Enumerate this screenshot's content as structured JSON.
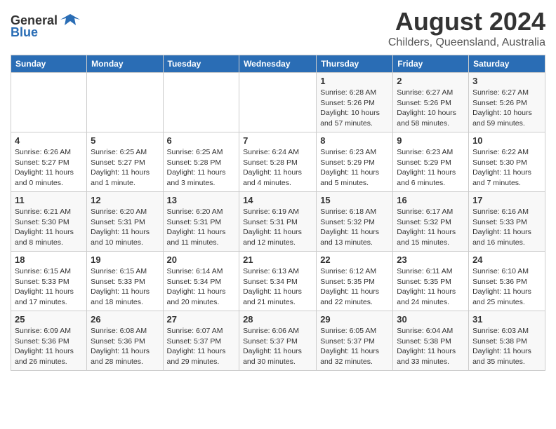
{
  "header": {
    "logo_general": "General",
    "logo_blue": "Blue",
    "title": "August 2024",
    "subtitle": "Childers, Queensland, Australia"
  },
  "calendar": {
    "days_of_week": [
      "Sunday",
      "Monday",
      "Tuesday",
      "Wednesday",
      "Thursday",
      "Friday",
      "Saturday"
    ],
    "weeks": [
      [
        {
          "day": "",
          "info": ""
        },
        {
          "day": "",
          "info": ""
        },
        {
          "day": "",
          "info": ""
        },
        {
          "day": "",
          "info": ""
        },
        {
          "day": "1",
          "info": "Sunrise: 6:28 AM\nSunset: 5:26 PM\nDaylight: 10 hours and 57 minutes."
        },
        {
          "day": "2",
          "info": "Sunrise: 6:27 AM\nSunset: 5:26 PM\nDaylight: 10 hours and 58 minutes."
        },
        {
          "day": "3",
          "info": "Sunrise: 6:27 AM\nSunset: 5:26 PM\nDaylight: 10 hours and 59 minutes."
        }
      ],
      [
        {
          "day": "4",
          "info": "Sunrise: 6:26 AM\nSunset: 5:27 PM\nDaylight: 11 hours and 0 minutes."
        },
        {
          "day": "5",
          "info": "Sunrise: 6:25 AM\nSunset: 5:27 PM\nDaylight: 11 hours and 1 minute."
        },
        {
          "day": "6",
          "info": "Sunrise: 6:25 AM\nSunset: 5:28 PM\nDaylight: 11 hours and 3 minutes."
        },
        {
          "day": "7",
          "info": "Sunrise: 6:24 AM\nSunset: 5:28 PM\nDaylight: 11 hours and 4 minutes."
        },
        {
          "day": "8",
          "info": "Sunrise: 6:23 AM\nSunset: 5:29 PM\nDaylight: 11 hours and 5 minutes."
        },
        {
          "day": "9",
          "info": "Sunrise: 6:23 AM\nSunset: 5:29 PM\nDaylight: 11 hours and 6 minutes."
        },
        {
          "day": "10",
          "info": "Sunrise: 6:22 AM\nSunset: 5:30 PM\nDaylight: 11 hours and 7 minutes."
        }
      ],
      [
        {
          "day": "11",
          "info": "Sunrise: 6:21 AM\nSunset: 5:30 PM\nDaylight: 11 hours and 8 minutes."
        },
        {
          "day": "12",
          "info": "Sunrise: 6:20 AM\nSunset: 5:31 PM\nDaylight: 11 hours and 10 minutes."
        },
        {
          "day": "13",
          "info": "Sunrise: 6:20 AM\nSunset: 5:31 PM\nDaylight: 11 hours and 11 minutes."
        },
        {
          "day": "14",
          "info": "Sunrise: 6:19 AM\nSunset: 5:31 PM\nDaylight: 11 hours and 12 minutes."
        },
        {
          "day": "15",
          "info": "Sunrise: 6:18 AM\nSunset: 5:32 PM\nDaylight: 11 hours and 13 minutes."
        },
        {
          "day": "16",
          "info": "Sunrise: 6:17 AM\nSunset: 5:32 PM\nDaylight: 11 hours and 15 minutes."
        },
        {
          "day": "17",
          "info": "Sunrise: 6:16 AM\nSunset: 5:33 PM\nDaylight: 11 hours and 16 minutes."
        }
      ],
      [
        {
          "day": "18",
          "info": "Sunrise: 6:15 AM\nSunset: 5:33 PM\nDaylight: 11 hours and 17 minutes."
        },
        {
          "day": "19",
          "info": "Sunrise: 6:15 AM\nSunset: 5:33 PM\nDaylight: 11 hours and 18 minutes."
        },
        {
          "day": "20",
          "info": "Sunrise: 6:14 AM\nSunset: 5:34 PM\nDaylight: 11 hours and 20 minutes."
        },
        {
          "day": "21",
          "info": "Sunrise: 6:13 AM\nSunset: 5:34 PM\nDaylight: 11 hours and 21 minutes."
        },
        {
          "day": "22",
          "info": "Sunrise: 6:12 AM\nSunset: 5:35 PM\nDaylight: 11 hours and 22 minutes."
        },
        {
          "day": "23",
          "info": "Sunrise: 6:11 AM\nSunset: 5:35 PM\nDaylight: 11 hours and 24 minutes."
        },
        {
          "day": "24",
          "info": "Sunrise: 6:10 AM\nSunset: 5:36 PM\nDaylight: 11 hours and 25 minutes."
        }
      ],
      [
        {
          "day": "25",
          "info": "Sunrise: 6:09 AM\nSunset: 5:36 PM\nDaylight: 11 hours and 26 minutes."
        },
        {
          "day": "26",
          "info": "Sunrise: 6:08 AM\nSunset: 5:36 PM\nDaylight: 11 hours and 28 minutes."
        },
        {
          "day": "27",
          "info": "Sunrise: 6:07 AM\nSunset: 5:37 PM\nDaylight: 11 hours and 29 minutes."
        },
        {
          "day": "28",
          "info": "Sunrise: 6:06 AM\nSunset: 5:37 PM\nDaylight: 11 hours and 30 minutes."
        },
        {
          "day": "29",
          "info": "Sunrise: 6:05 AM\nSunset: 5:37 PM\nDaylight: 11 hours and 32 minutes."
        },
        {
          "day": "30",
          "info": "Sunrise: 6:04 AM\nSunset: 5:38 PM\nDaylight: 11 hours and 33 minutes."
        },
        {
          "day": "31",
          "info": "Sunrise: 6:03 AM\nSunset: 5:38 PM\nDaylight: 11 hours and 35 minutes."
        }
      ]
    ]
  }
}
